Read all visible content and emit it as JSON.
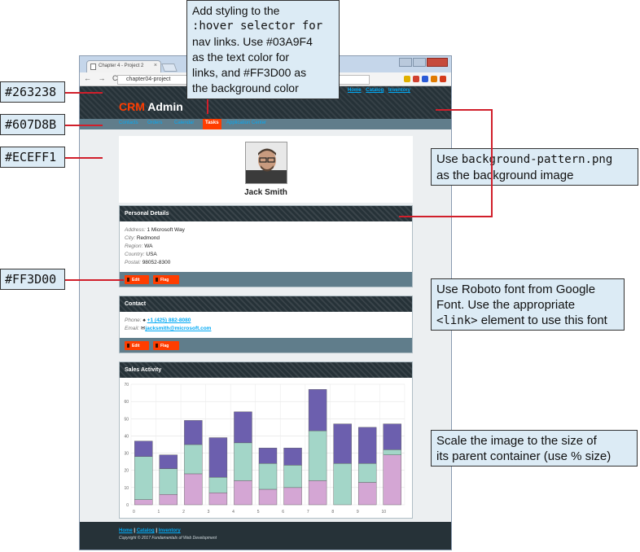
{
  "browser": {
    "tab_title": "Chapter 4 - Project 2",
    "tab_close": "×",
    "nav_arrows": "← → C ⌂",
    "url": "chapter04-project"
  },
  "site": {
    "logo_crm": "CRM",
    "logo_admin": " Admin",
    "top_links": [
      "Home",
      "Catalog",
      "Inventory"
    ],
    "nav": [
      "Contacts",
      "Orders",
      "Calendar",
      "Tasks",
      "Application Center"
    ],
    "active_nav": "Tasks",
    "profile_name": "Jack Smith",
    "personal": {
      "title": "Personal Details",
      "address_label": "Address:",
      "address": "1 Microsoft Way",
      "city_label": "City:",
      "city": "Redmond",
      "region_label": "Region:",
      "region": "WA",
      "country_label": "Country:",
      "country": "USA",
      "postal_label": "Postal:",
      "postal": "98052-8300"
    },
    "contact": {
      "title": "Contact",
      "phone_label": "Phone:",
      "phone": "+1 (425) 882-8080",
      "email_label": "Email:",
      "email": "jacksmith@microsoft.com"
    },
    "buttons": {
      "edit": "Edit",
      "flag": "Flag"
    },
    "sales_title": "Sales Activity",
    "footer_links": [
      "Home",
      "Catalog",
      "Inventory"
    ],
    "footer_sep": " | ",
    "copyright": "Copyright © 2017 Fundamentals of Web Development"
  },
  "colors": {
    "header": "#263238",
    "nav": "#607D8B",
    "background": "#ECEFF1",
    "accent": "#FF3D00",
    "link": "#03A9F4",
    "series": [
      "#d4a6d4",
      "#a3d6c8",
      "#6c5fae"
    ]
  },
  "annotations": {
    "hover": [
      "Add styling to the",
      ":hover selector for",
      "nav links. Use #03A9F4",
      "as the text color for",
      "links, and #FF3D00 as",
      "the background color"
    ],
    "bg_pattern_mono": "background-pattern.png",
    "bg_pattern_line2": "as the background image",
    "roboto": [
      "Use Roboto font from Google",
      "Font. Use the appropriate"
    ],
    "roboto_mono": "<link>",
    "roboto_tail": " element to use this font",
    "scale": [
      "Scale the image to the size of",
      "its parent container (use % size)"
    ],
    "labels": [
      "#263238",
      "#607D8B",
      "#ECEFF1",
      "#FF3D00"
    ]
  },
  "chart_data": {
    "type": "bar",
    "stacked": true,
    "categories": [
      "0",
      "1",
      "2",
      "3",
      "4",
      "5",
      "6",
      "7",
      "8",
      "9",
      "10"
    ],
    "series": [
      {
        "values": [
          3,
          6,
          18,
          7,
          14,
          9,
          10,
          14,
          0,
          13,
          29
        ]
      },
      {
        "values": [
          25,
          15,
          17,
          9,
          22,
          15,
          13,
          29,
          24,
          11,
          3
        ]
      },
      {
        "values": [
          9,
          8,
          14,
          23,
          18,
          9,
          10,
          24,
          23,
          21,
          15
        ]
      }
    ],
    "ylim": [
      0,
      70
    ],
    "yticks": [
      0,
      10,
      20,
      30,
      40,
      50,
      60,
      70
    ],
    "grid": true
  }
}
